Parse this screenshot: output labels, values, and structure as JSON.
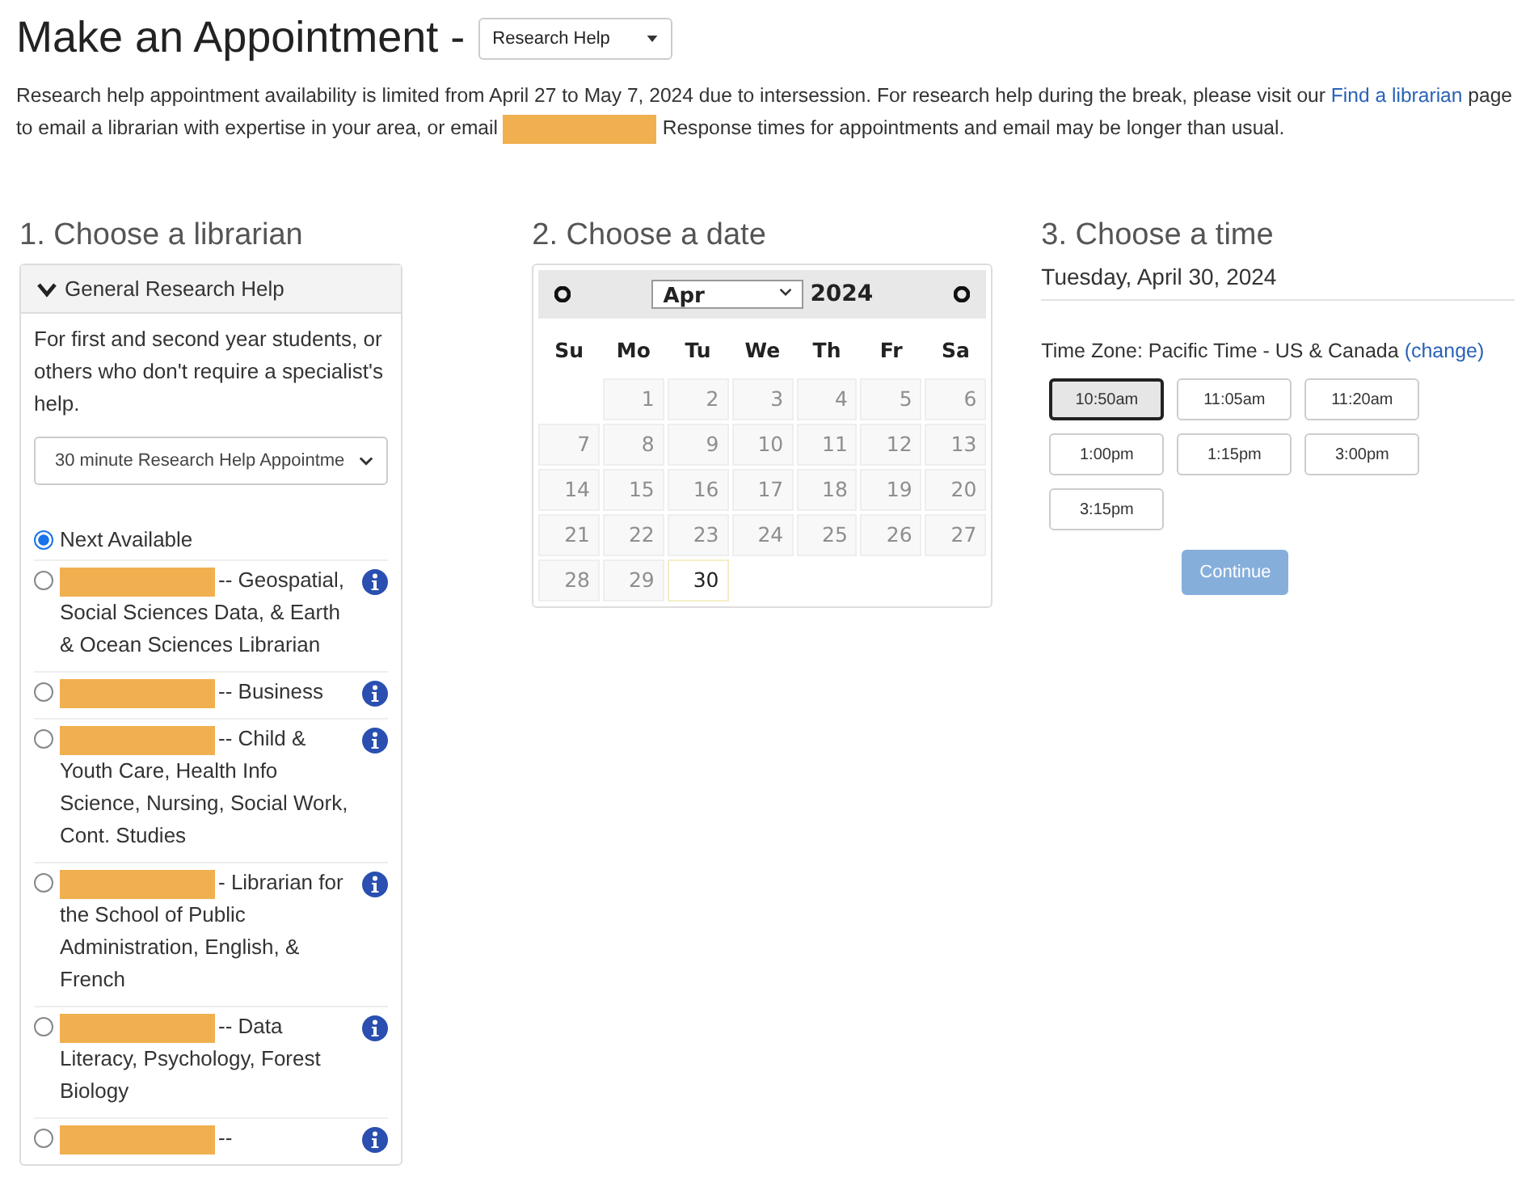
{
  "title": "Make an Appointment -",
  "category_select": {
    "value": "Research Help"
  },
  "notice": {
    "before": "Research help appointment availability is limited from April 27 to May 7, 2024  due to intersession. For research help during the break, please visit our",
    "link": "Find a librarian",
    "middle": "page to email a librarian with expertise in your area, or email",
    "email_redacted": true,
    "after": "Response times for appointments and email may be longer than usual."
  },
  "librarian_section": {
    "heading": "1. Choose a librarian",
    "group": {
      "label": "General Research Help",
      "expanded": true,
      "description": "For first and second year students, or others who don't require a specialist's help.",
      "appointment_select": {
        "value": "30 minute Research Help Appointme"
      },
      "options": [
        {
          "label": "Next Available",
          "redacted": false,
          "selected": true,
          "info": false
        },
        {
          "label": "-- Geospatial, Social Sciences Data, & Earth & Ocean Sciences Librarian",
          "redacted": true,
          "selected": false,
          "info": true
        },
        {
          "label": "-- Business",
          "redacted": true,
          "selected": false,
          "info": true
        },
        {
          "label": "-- Child & Youth Care, Health Info Science, Nursing, Social Work, Cont. Studies",
          "redacted": true,
          "selected": false,
          "info": true
        },
        {
          "label": "- Librarian for the School of Public Administration, English, & French",
          "redacted": true,
          "selected": false,
          "info": true
        },
        {
          "label": "-- Data Literacy, Psychology, Forest Biology",
          "redacted": true,
          "selected": false,
          "info": true
        },
        {
          "label": "--",
          "redacted": true,
          "selected": false,
          "info": true
        }
      ]
    }
  },
  "date_section": {
    "heading": "2. Choose a date",
    "month": "Apr",
    "year": "2024",
    "weekdays": [
      "Su",
      "Mo",
      "Tu",
      "We",
      "Th",
      "Fr",
      "Sa"
    ],
    "weeks": [
      [
        {
          "day": "1",
          "disabled": true,
          "selected": false
        },
        {
          "day": "2",
          "disabled": true,
          "selected": false
        },
        {
          "day": "3",
          "disabled": true,
          "selected": false
        },
        {
          "day": "4",
          "disabled": true,
          "selected": false
        },
        {
          "day": "5",
          "disabled": true,
          "selected": false
        },
        {
          "day": "6",
          "disabled": true,
          "selected": false
        }
      ],
      [
        {
          "day": "7",
          "disabled": true,
          "selected": false
        },
        {
          "day": "8",
          "disabled": true,
          "selected": false
        },
        {
          "day": "9",
          "disabled": true,
          "selected": false
        },
        {
          "day": "10",
          "disabled": true,
          "selected": false
        },
        {
          "day": "11",
          "disabled": true,
          "selected": false
        },
        {
          "day": "12",
          "disabled": true,
          "selected": false
        },
        {
          "day": "13",
          "disabled": true,
          "selected": false
        }
      ],
      [
        {
          "day": "14",
          "disabled": true,
          "selected": false
        },
        {
          "day": "15",
          "disabled": true,
          "selected": false
        },
        {
          "day": "16",
          "disabled": true,
          "selected": false
        },
        {
          "day": "17",
          "disabled": true,
          "selected": false
        },
        {
          "day": "18",
          "disabled": true,
          "selected": false
        },
        {
          "day": "19",
          "disabled": true,
          "selected": false
        },
        {
          "day": "20",
          "disabled": true,
          "selected": false
        }
      ],
      [
        {
          "day": "21",
          "disabled": true,
          "selected": false
        },
        {
          "day": "22",
          "disabled": true,
          "selected": false
        },
        {
          "day": "23",
          "disabled": true,
          "selected": false
        },
        {
          "day": "24",
          "disabled": true,
          "selected": false
        },
        {
          "day": "25",
          "disabled": true,
          "selected": false
        },
        {
          "day": "26",
          "disabled": true,
          "selected": false
        },
        {
          "day": "27",
          "disabled": true,
          "selected": false
        }
      ],
      [
        {
          "day": "28",
          "disabled": true,
          "selected": false
        },
        {
          "day": "29",
          "disabled": true,
          "selected": false
        },
        {
          "day": "30",
          "disabled": false,
          "selected": true
        }
      ]
    ]
  },
  "time_section": {
    "heading": "3. Choose a time",
    "date": "Tuesday, April 30, 2024",
    "timezone": "Time Zone: Pacific Time - US & Canada",
    "change_link": "(change)",
    "slots": [
      {
        "label": "10:50am",
        "selected": true
      },
      {
        "label": "11:05am",
        "selected": false
      },
      {
        "label": "11:20am",
        "selected": false
      },
      {
        "label": "1:00pm",
        "selected": false
      },
      {
        "label": "1:15pm",
        "selected": false
      },
      {
        "label": "3:00pm",
        "selected": false
      },
      {
        "label": "3:15pm",
        "selected": false
      }
    ],
    "continue_button": {
      "label": "Continue",
      "disabled": true
    }
  }
}
